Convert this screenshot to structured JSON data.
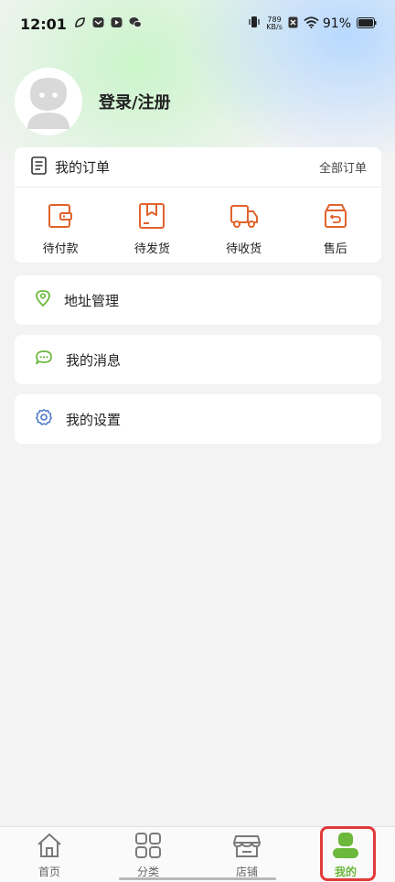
{
  "status_bar": {
    "time": "12:01",
    "net_speed_value": "789",
    "net_speed_unit": "KB/s",
    "battery": "91%"
  },
  "profile": {
    "login_label": "登录/注册"
  },
  "orders": {
    "title": "我的订单",
    "view_all": "全部订单",
    "items": [
      {
        "label": "待付款",
        "icon": "wallet-icon"
      },
      {
        "label": "待发货",
        "icon": "package-icon"
      },
      {
        "label": "待收货",
        "icon": "truck-icon"
      },
      {
        "label": "售后",
        "icon": "after-sales-icon"
      }
    ]
  },
  "menu": {
    "address": "地址管理",
    "messages": "我的消息",
    "settings": "我的设置"
  },
  "tabbar": {
    "items": [
      {
        "label": "首页",
        "icon": "home-icon"
      },
      {
        "label": "分类",
        "icon": "grid-icon"
      },
      {
        "label": "店铺",
        "icon": "store-icon"
      },
      {
        "label": "我的",
        "icon": "user-icon",
        "active": true
      }
    ]
  },
  "colors": {
    "accent_green": "#6bb83c",
    "order_icon_orange": "#e0622b",
    "highlight_red": "#e23a3a"
  }
}
